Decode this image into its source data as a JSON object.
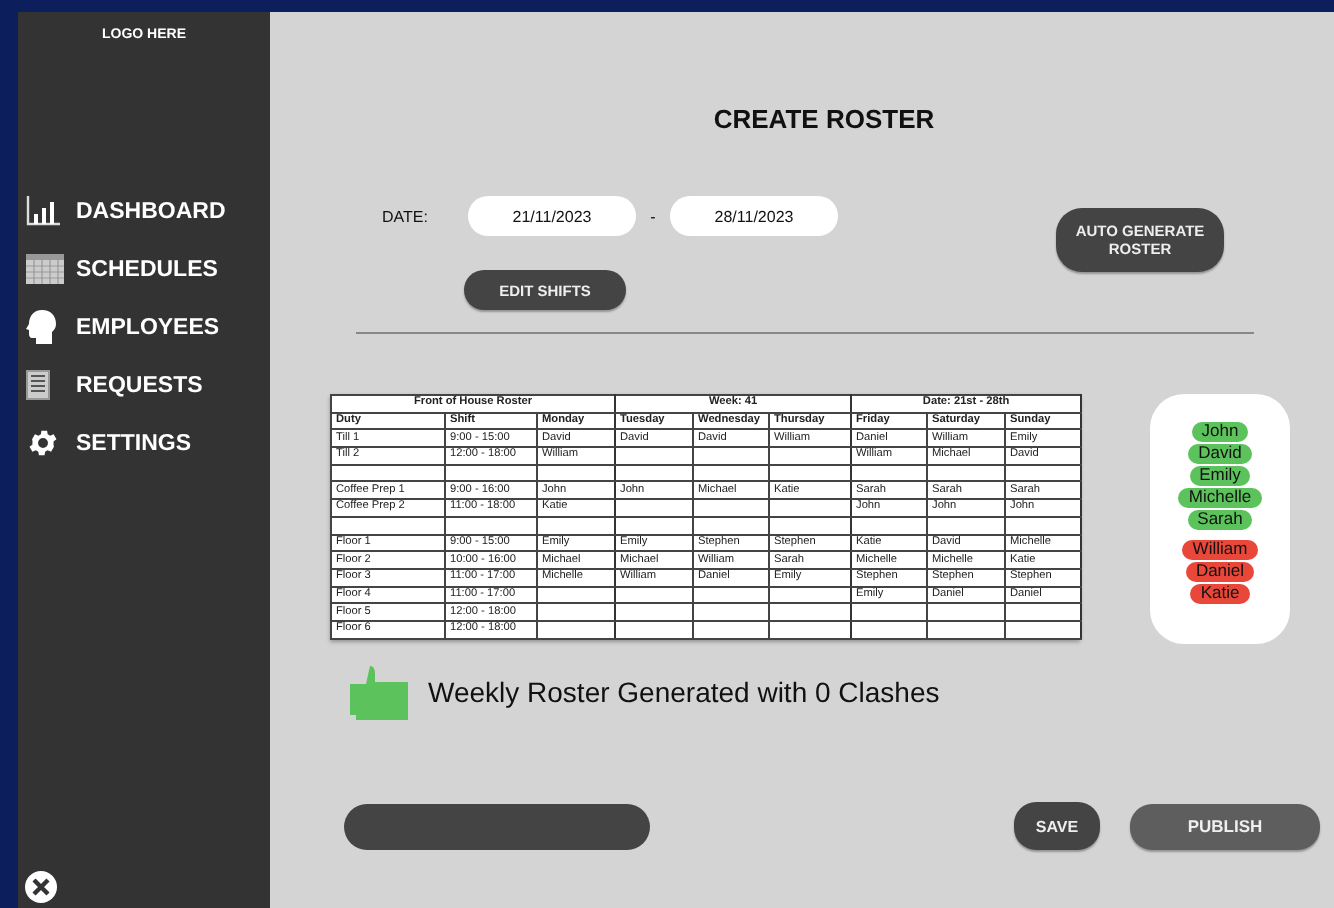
{
  "sidebar": {
    "logo": "LOGO HERE",
    "items": [
      {
        "label": "DASHBOARD"
      },
      {
        "label": "SCHEDULES"
      },
      {
        "label": "EMPLOYEES"
      },
      {
        "label": "REQUESTS"
      },
      {
        "label": "SETTINGS"
      }
    ]
  },
  "title": "CREATE ROSTER",
  "date": {
    "label": "DATE:",
    "start": "21/11/2023",
    "separator": "-",
    "end": "28/11/2023"
  },
  "buttons": {
    "edit_shifts": "EDIT SHIFTS",
    "auto_generate": "AUTO GENERATE ROSTER",
    "save": "SAVE",
    "publish": "PUBLISH"
  },
  "roster": {
    "groups": [
      {
        "label": "Front of House Roster"
      },
      {
        "label": "Week: 41"
      },
      {
        "label": "Date: 21st - 28th"
      }
    ],
    "columns": [
      "Duty",
      "Shift",
      "Monday",
      "Tuesday",
      "Wednesday",
      "Thursday",
      "Friday",
      "Saturday",
      "Sunday"
    ],
    "rows": [
      {
        "kind": "shift",
        "duty": "Till 1",
        "shift": "9:00 - 15:00",
        "days": {
          "mon": "David",
          "tue": "David",
          "wed": "David",
          "thu": "William",
          "fri": "Daniel",
          "sat": "William",
          "sun": "Emily"
        }
      },
      {
        "kind": "shift",
        "duty": "Till 2",
        "shift": "12:00 - 18:00",
        "days": {
          "mon": "William",
          "fri": "William",
          "sat": "Michael",
          "sun": "David"
        }
      },
      {
        "kind": "blank"
      },
      {
        "kind": "shift",
        "duty": "Coffee Prep 1",
        "shift": "9:00 - 16:00",
        "days": {
          "mon": "John",
          "tue": "John",
          "wed": "Michael",
          "thu": "Katie",
          "fri": "Sarah",
          "sat": "Sarah",
          "sun": "Sarah"
        }
      },
      {
        "kind": "shift",
        "duty": "Coffee Prep 2",
        "shift": "11:00 - 18:00",
        "days": {
          "mon": "Katie",
          "fri": "John",
          "sat": "John",
          "sun": "John"
        }
      },
      {
        "kind": "blank"
      },
      {
        "kind": "shift",
        "duty": "Floor 1",
        "shift": "9:00 - 15:00",
        "days": {
          "mon": "Emily",
          "tue": "Emily",
          "wed": "Stephen",
          "thu": "Stephen",
          "fri": "Katie",
          "sat": "David",
          "sun": "Michelle"
        }
      },
      {
        "kind": "shift",
        "duty": "Floor 2",
        "shift": "10:00 - 16:00",
        "days": {
          "mon": "Michael",
          "tue": "Michael",
          "wed": "William",
          "thu": "Sarah",
          "fri": "Michelle",
          "sat": "Michelle",
          "sun": "Katie"
        }
      },
      {
        "kind": "shift",
        "duty": "Floor 3",
        "shift": "11:00 - 17:00",
        "days": {
          "mon": "Michelle",
          "tue": "William",
          "wed": "Daniel",
          "thu": "Emily",
          "fri": "Stephen",
          "sat": "Stephen",
          "sun": "Stephen"
        }
      },
      {
        "kind": "shift",
        "duty": "Floor 4",
        "shift": "11:00 - 17:00",
        "days": {
          "fri": "Emily",
          "sat": "Daniel",
          "sun": "Daniel"
        }
      },
      {
        "kind": "shift",
        "duty": "Floor 5",
        "shift": "12:00 - 18:00"
      },
      {
        "kind": "shift",
        "duty": "Floor 6",
        "shift": "12:00 - 18:00"
      }
    ]
  },
  "staff": [
    {
      "name": "John",
      "color": "#5cc35c"
    },
    {
      "name": "David",
      "color": "#5cc35c"
    },
    {
      "name": "Emily",
      "color": "#5cc35c"
    },
    {
      "name": "Michelle",
      "color": "#5cc35c"
    },
    {
      "name": "Sarah",
      "color": "#5cc35c"
    },
    {
      "name": "William",
      "color": "#e8473a"
    },
    {
      "name": "Daniel",
      "color": "#e8473a"
    },
    {
      "name": "Katie",
      "color": "#e8473a"
    }
  ],
  "message": "Weekly Roster Generated with 0 Clashes"
}
